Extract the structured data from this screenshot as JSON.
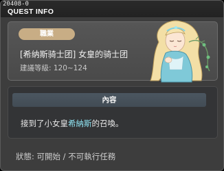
{
  "window": {
    "quest_id": "20408-0",
    "title": "QUEST INFO"
  },
  "job": {
    "badge_label": "職業",
    "quest_name": "[希纳斯骑士团] 女皇的骑士团",
    "level_requirement": "建議等級: 120~124"
  },
  "content": {
    "header": "內容",
    "text_before": "接到了小女皇",
    "text_highlight": "希納斯",
    "text_after": "的召喚。"
  },
  "status": {
    "text": "狀態: 可開始 / 不可執行任務"
  },
  "colors": {
    "badge": "#c8ad85",
    "highlight": "#8fe3f2",
    "content_header": "#4b5660"
  }
}
